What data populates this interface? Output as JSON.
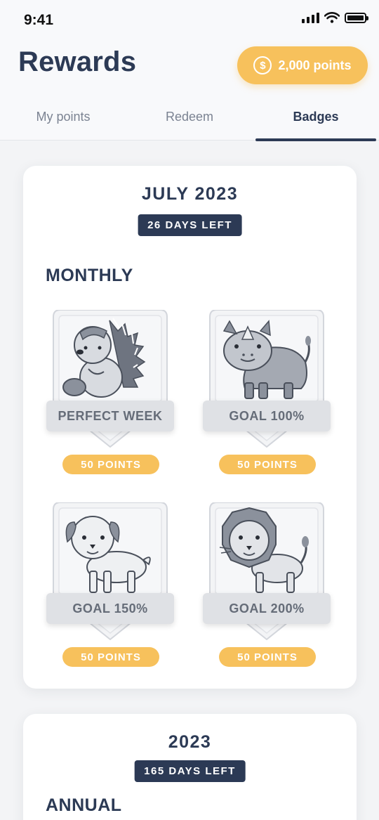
{
  "status_bar": {
    "time": "9:41"
  },
  "header": {
    "title": "Rewards",
    "points_pill": "2,000 points",
    "coin_symbol": "$"
  },
  "tabs": [
    {
      "label": "My points",
      "active": false
    },
    {
      "label": "Redeem",
      "active": false
    },
    {
      "label": "Badges",
      "active": true
    }
  ],
  "monthly_card": {
    "title": "JULY 2023",
    "days_left": "26 DAYS LEFT",
    "section_title": "MONTHLY",
    "badges": [
      {
        "label": "PERFECT WEEK",
        "points": "50 POINTS",
        "icon": "porcupine-icon"
      },
      {
        "label": "GOAL 100%",
        "points": "50 POINTS",
        "icon": "rhino-icon"
      },
      {
        "label": "GOAL 150%",
        "points": "50 POINTS",
        "icon": "dog-icon"
      },
      {
        "label": "GOAL 200%",
        "points": "50 POINTS",
        "icon": "lion-icon"
      }
    ]
  },
  "annual_card": {
    "title": "2023",
    "days_left": "165 DAYS LEFT",
    "section_title": "ANNUAL"
  },
  "colors": {
    "navy": "#2c3a55",
    "gold": "#f7c15c",
    "badge_gray": "#dfe1e5"
  }
}
